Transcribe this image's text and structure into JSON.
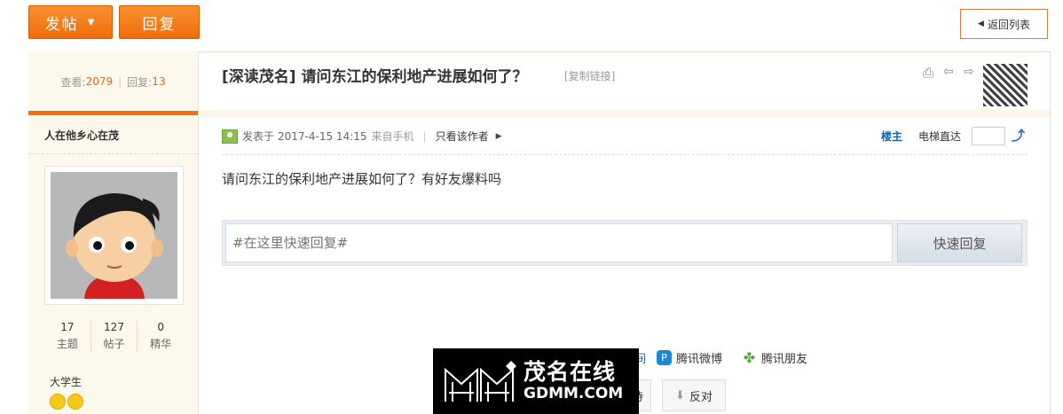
{
  "toolbar": {
    "post_label": "发帖",
    "reply_label": "回复",
    "back_label": "返回列表"
  },
  "sidebar": {
    "views_label": "查看:",
    "views_value": "2079",
    "replies_label": "回复:",
    "replies_value": "13",
    "author_name": "人在他乡心在茂",
    "stats": [
      {
        "value": "17",
        "label": "主题"
      },
      {
        "value": "127",
        "label": "帖子"
      },
      {
        "value": "0",
        "label": "精华"
      }
    ],
    "rank": "大学生"
  },
  "thread": {
    "title": "[深读茂名] 请问东江的保利地产进展如何了？",
    "copy_link": "[复制链接]"
  },
  "post": {
    "posted_prefix": "发表于",
    "posted_time": "2017-4-15 14:15",
    "source": "来自手机",
    "only_author": "只看该作者",
    "floor_label": "楼主",
    "elevator_label": "电梯直达",
    "body": "请问东江的保利地产进展如何了？有好友爆料吗"
  },
  "quick_reply": {
    "placeholder": "#在这里快速回复#",
    "button_label": "快速回复"
  },
  "share": {
    "partial_label": "间",
    "weibo_label": "腾讯微博",
    "friend_label": "腾讯朋友"
  },
  "votes": {
    "support_partial": "持",
    "oppose_label": "反对"
  },
  "watermark": {
    "cn": "茂名在线",
    "en": "GDMM.COM"
  },
  "colors": {
    "accent": "#f36b12",
    "link": "#1a5bb0",
    "sidebar_bg": "#fcf8ec"
  }
}
